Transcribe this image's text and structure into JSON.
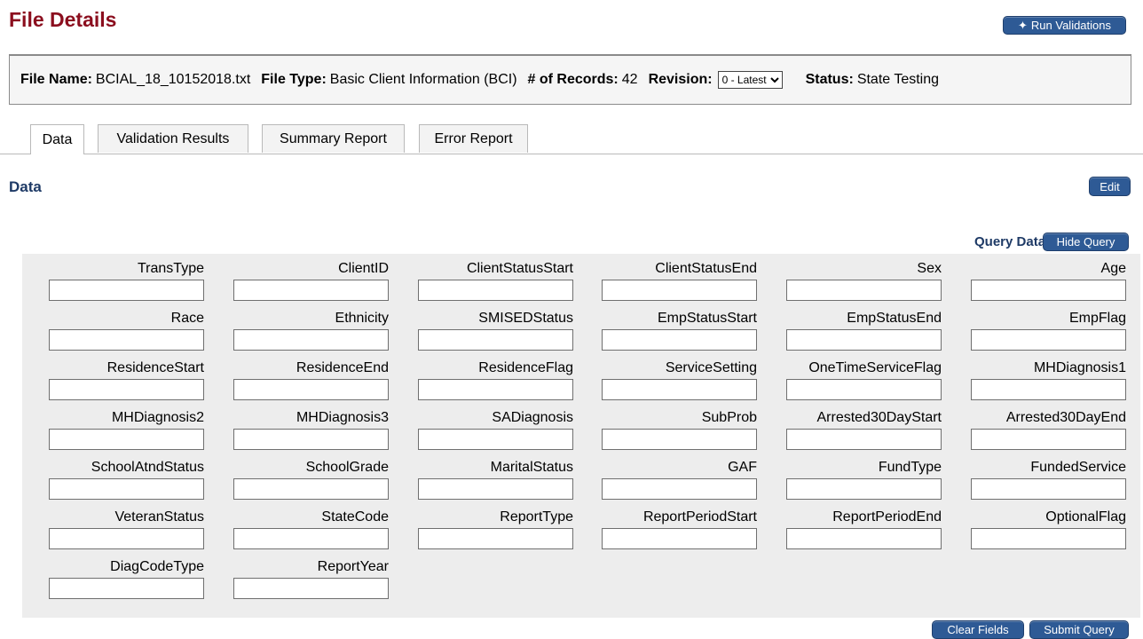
{
  "header": {
    "title": "File Details",
    "run_validations": "Run Validations",
    "run_icon": "runner-icon"
  },
  "file_info": {
    "name_label": "File Name:",
    "name_value": "BCIAL_18_10152018.txt",
    "type_label": "File Type:",
    "type_value": "Basic Client Information (BCI)",
    "records_label": "# of Records:",
    "records_value": "42",
    "revision_label": "Revision:",
    "revision_value": "0 - Latest",
    "status_label": "Status:",
    "status_value": "State Testing"
  },
  "tabs": [
    {
      "label": "Data",
      "active": true
    },
    {
      "label": "Validation Results",
      "active": false
    },
    {
      "label": "Summary Report",
      "active": false
    },
    {
      "label": "Error Report",
      "active": false
    }
  ],
  "section": {
    "title": "Data",
    "edit_label": "Edit"
  },
  "query": {
    "label": "Query Data",
    "hide_label": "Hide Query",
    "clear_label": "Clear Fields",
    "submit_label": "Submit Query",
    "fields": [
      {
        "label": "TransType",
        "value": ""
      },
      {
        "label": "ClientID",
        "value": ""
      },
      {
        "label": "ClientStatusStart",
        "value": ""
      },
      {
        "label": "ClientStatusEnd",
        "value": ""
      },
      {
        "label": "Sex",
        "value": ""
      },
      {
        "label": "Age",
        "value": ""
      },
      {
        "label": "Race",
        "value": ""
      },
      {
        "label": "Ethnicity",
        "value": ""
      },
      {
        "label": "SMISEDStatus",
        "value": ""
      },
      {
        "label": "EmpStatusStart",
        "value": ""
      },
      {
        "label": "EmpStatusEnd",
        "value": ""
      },
      {
        "label": "EmpFlag",
        "value": ""
      },
      {
        "label": "ResidenceStart",
        "value": ""
      },
      {
        "label": "ResidenceEnd",
        "value": ""
      },
      {
        "label": "ResidenceFlag",
        "value": ""
      },
      {
        "label": "ServiceSetting",
        "value": ""
      },
      {
        "label": "OneTimeServiceFlag",
        "value": ""
      },
      {
        "label": "MHDiagnosis1",
        "value": ""
      },
      {
        "label": "MHDiagnosis2",
        "value": ""
      },
      {
        "label": "MHDiagnosis3",
        "value": ""
      },
      {
        "label": "SADiagnosis",
        "value": ""
      },
      {
        "label": "SubProb",
        "value": ""
      },
      {
        "label": "Arrested30DayStart",
        "value": ""
      },
      {
        "label": "Arrested30DayEnd",
        "value": ""
      },
      {
        "label": "SchoolAtndStatus",
        "value": ""
      },
      {
        "label": "SchoolGrade",
        "value": ""
      },
      {
        "label": "MaritalStatus",
        "value": ""
      },
      {
        "label": "GAF",
        "value": ""
      },
      {
        "label": "FundType",
        "value": ""
      },
      {
        "label": "FundedService",
        "value": ""
      },
      {
        "label": "VeteranStatus",
        "value": ""
      },
      {
        "label": "StateCode",
        "value": ""
      },
      {
        "label": "ReportType",
        "value": ""
      },
      {
        "label": "ReportPeriodStart",
        "value": ""
      },
      {
        "label": "ReportPeriodEnd",
        "value": ""
      },
      {
        "label": "OptionalFlag",
        "value": ""
      },
      {
        "label": "DiagCodeType",
        "value": ""
      },
      {
        "label": "ReportYear",
        "value": ""
      }
    ]
  },
  "colors": {
    "title": "#8b0e1e",
    "button": "#2e5a95",
    "section_title": "#1e3a66",
    "panel": "#ededed"
  }
}
